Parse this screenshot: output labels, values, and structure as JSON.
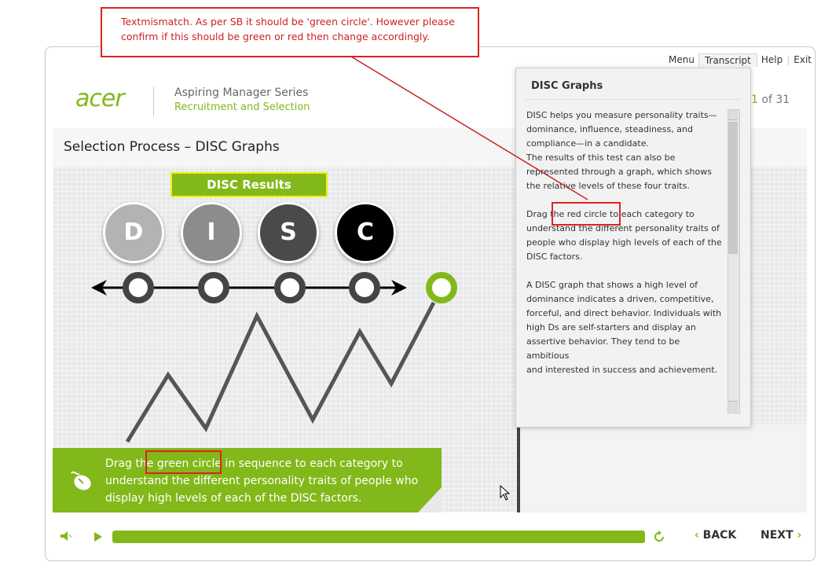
{
  "annotation": {
    "line1": "Textmismatch. As per SB it should be 'green circle'. However please",
    "line2": "confirm if this should be green or red then change accordingly."
  },
  "brand": {
    "logo": "acer",
    "series": "Aspiring Manager Series",
    "subseries": "Recruitment and Selection"
  },
  "top_menu": {
    "menu": "Menu",
    "transcript": "Transcript",
    "help": "Help",
    "exit": "Exit"
  },
  "page_counter": {
    "current": "1",
    "of_text": " of 31"
  },
  "page_title": "Selection Process – DISC Graphs",
  "disc_results_label": "DISC Results",
  "disc_letters": [
    "D",
    "I",
    "S",
    "C"
  ],
  "instruction": {
    "pre": "Drag th",
    "highlight": "e green circle",
    "post": " in sequence to each category to understand the different personality traits of people who display high levels of each of the DISC factors."
  },
  "transcript": {
    "title": "DISC Graphs",
    "p1": "DISC helps you measure personality traits—dominance, influence, steadiness, and compliance—in a candidate.\nThe results of this test can also be represented through a graph, which shows the relative levels of these four traits.",
    "p2": "Drag the red circle to each category to understand the different personality traits of people who display high levels of each of the DISC factors.",
    "p3": "A DISC graph that shows a high level of dominance indicates a driven, competitive, forceful, and direct behavior. Individuals with\nhigh Ds are self-starters and display an assertive behavior. They tend to be ambitious\nand interested in success and achievement."
  },
  "nav": {
    "back": "BACK",
    "next": "NEXT"
  },
  "colors": {
    "accent": "#83b81a",
    "annotation": "#cc2222",
    "dark": "#444444"
  },
  "icons": [
    "volume-icon",
    "play-icon",
    "replay-icon",
    "mouse-icon",
    "cursor-icon"
  ]
}
